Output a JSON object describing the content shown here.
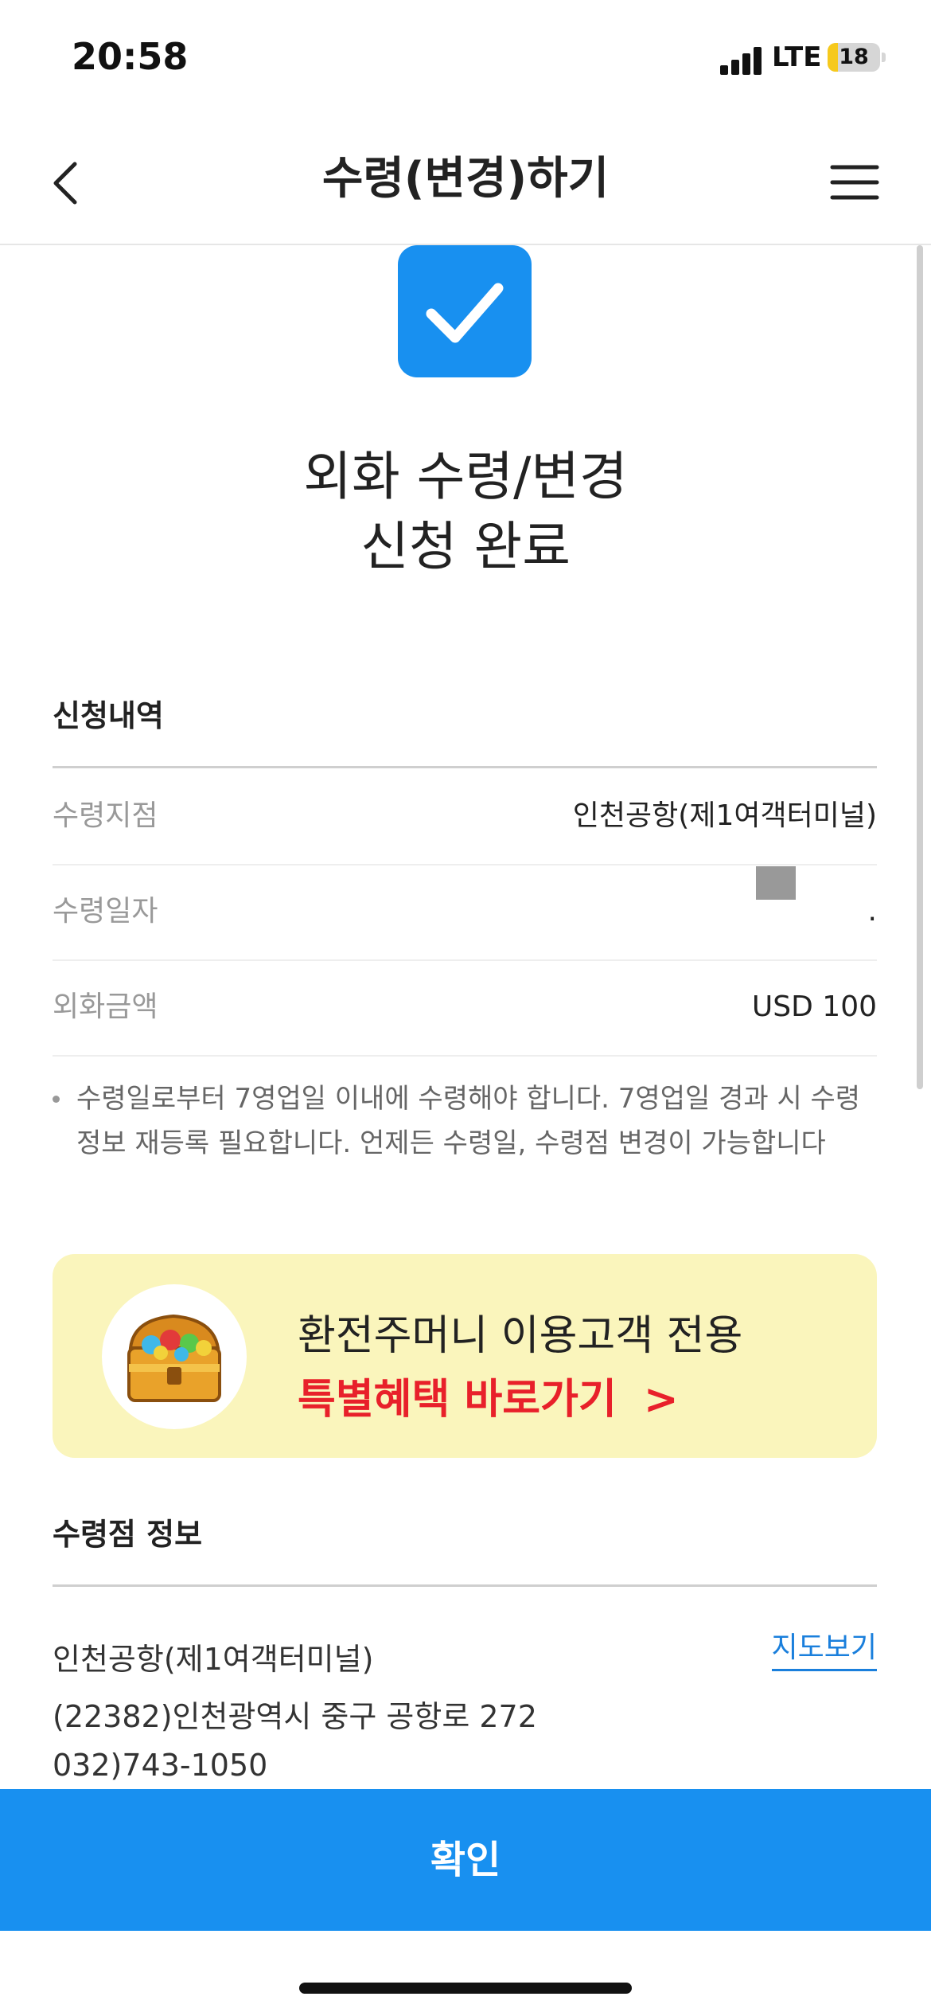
{
  "status_bar": {
    "time": "20:58",
    "network": "LTE",
    "battery_level": "18",
    "battery_fraction": 0.2
  },
  "header": {
    "title": "수령(변경)하기",
    "back_icon": "chevron-left-icon",
    "menu_icon": "hamburger-menu-icon"
  },
  "completion": {
    "icon": "check-icon",
    "title_line1": "외화 수령/변경",
    "title_line2": "신청 완료",
    "accent_color": "#1890f0"
  },
  "application": {
    "section_title": "신청내역",
    "rows": [
      {
        "label": "수령지점",
        "value": "인천공항(제1여객터미널)"
      },
      {
        "label": "수령일자",
        "value": "."
      },
      {
        "label": "외화금액",
        "value": "USD 100"
      }
    ],
    "notice": "수령일로부터 7영업일 이내에 수령해야 합니다. 7영업일 경과 시 수령정보 재등록 필요합니다. 언제든 수령일, 수령점 변경이 가능합니다"
  },
  "banner": {
    "icon": "treasure-chest-icon",
    "line1": "환전주머니 이용고객 전용",
    "line2": "특별혜택 바로가기",
    "chevron": ">",
    "background_color": "#faf5bc",
    "highlight_color": "#e8202a"
  },
  "branch_info": {
    "section_title": "수령점 정보",
    "name": "인천공항(제1여객터미널)",
    "address": "(22382)인천광역시 중구 공항로 272",
    "phone": "032)743-1050",
    "map_link": "지도보기"
  },
  "footer": {
    "confirm_label": "확인"
  }
}
